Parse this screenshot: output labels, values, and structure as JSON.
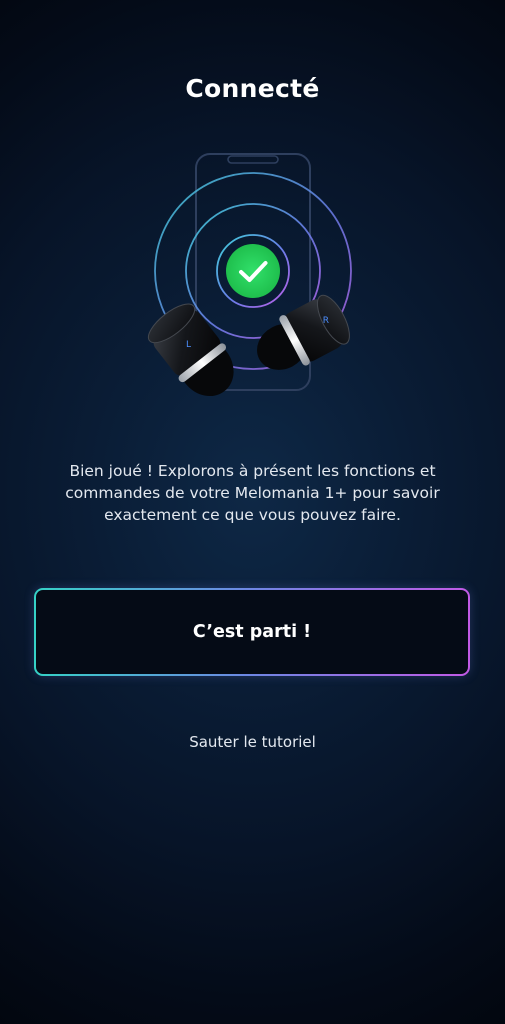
{
  "screen": {
    "title": "Connecté",
    "message": "Bien joué ! Explorons à présent les fonctions et commandes de votre Melomania 1+ pour savoir exactement ce que vous pouvez faire.",
    "primary_button_label": "C’est parti !",
    "skip_link_label": "Sauter le tutoriel"
  },
  "illustration": {
    "phone_icon": "phone-outline-icon",
    "check_icon": "check-circle-icon",
    "earbud_icon": "earbud-icon",
    "left_bud_letter": "L",
    "right_bud_letter": "R"
  },
  "colors": {
    "background_dark": "#02060e",
    "background_mid": "#0e2846",
    "success_green": "#27d35a",
    "gradient_start": "#35d2c6",
    "gradient_end": "#c25ae6"
  }
}
